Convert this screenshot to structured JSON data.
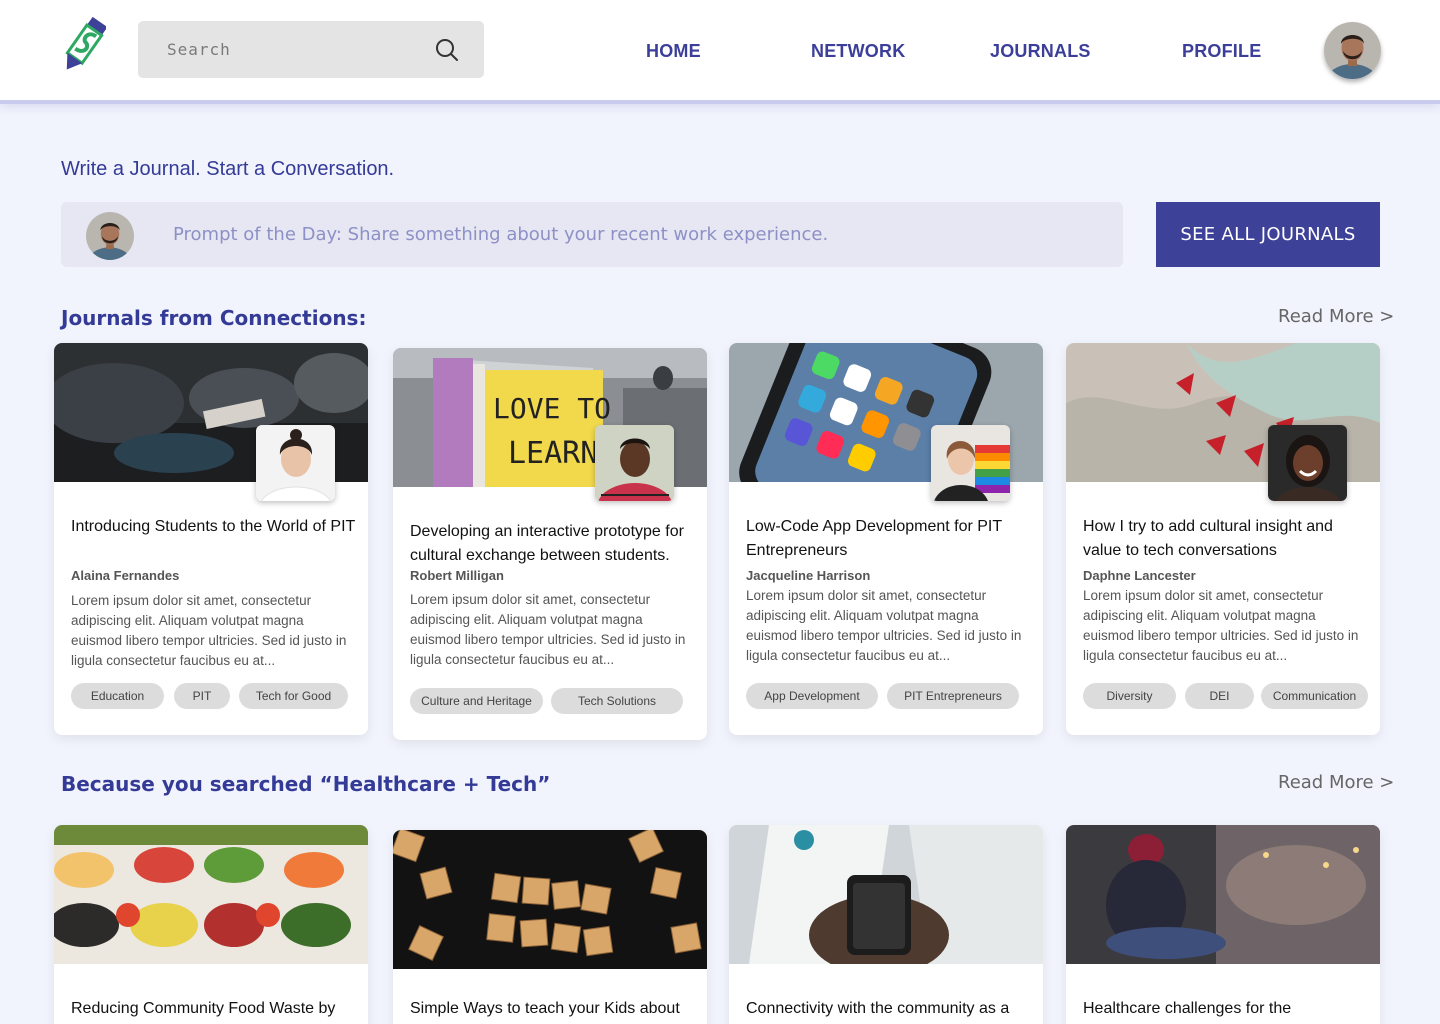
{
  "header": {
    "search_placeholder": "Search",
    "nav": [
      "HOME",
      "NETWORK",
      "JOURNALS",
      "PROFILE"
    ]
  },
  "intro": {
    "title": "Write a Journal. Start a Conversation.",
    "prompt": "Prompt of the Day: Share something about your recent work experience.",
    "see_all": "SEE ALL JOURNALS"
  },
  "connections": {
    "title": "Journals from Connections:",
    "read_more": "Read More >",
    "cards": [
      {
        "title": "Introducing Students to the World of PIT",
        "author": "Alaina Fernandes",
        "body": "Lorem ipsum dolor sit amet, consectetur adipiscing elit. Aliquam volutpat magna euismod libero tempor ultricies. Sed id justo in ligula consectetur faucibus eu at...",
        "tags": [
          "Education",
          "PIT",
          "Tech for Good"
        ]
      },
      {
        "title": "Developing an interactive prototype for cultural exchange between students.",
        "author": "Robert Milligan",
        "body": "Lorem ipsum dolor sit amet, consectetur adipiscing elit. Aliquam volutpat magna euismod libero tempor ultricies. Sed id justo in ligula consectetur faucibus eu at...",
        "tags": [
          "Culture and Heritage",
          "Tech Solutions"
        ]
      },
      {
        "title": "Low-Code App Development for PIT Entrepreneurs",
        "author": "Jacqueline Harrison",
        "body": "Lorem ipsum dolor sit amet, consectetur adipiscing elit. Aliquam volutpat magna euismod libero tempor ultricies. Sed id justo in ligula consectetur faucibus eu at...",
        "tags": [
          "App Development",
          "PIT Entrepreneurs"
        ]
      },
      {
        "title": "How I try to add cultural insight and value to tech conversations",
        "author": "Daphne Lancester",
        "body": "Lorem ipsum dolor sit amet, consectetur adipiscing elit. Aliquam volutpat magna euismod libero tempor ultricies. Sed id justo in ligula consectetur faucibus eu at...",
        "tags": [
          "Diversity",
          "DEI",
          "Communication"
        ]
      }
    ]
  },
  "searched": {
    "title": "Because you searched “Healthcare + Tech”",
    "read_more": "Read More >",
    "cards": [
      {
        "title": "Reducing Community Food Waste by"
      },
      {
        "title": "Simple Ways to teach your Kids about"
      },
      {
        "title": "Connectivity with the community as a"
      },
      {
        "title": "Healthcare challenges for the"
      }
    ]
  },
  "colors": {
    "brand": "#3e4198",
    "accent_text": "#343b96",
    "background": "#f1f3fd"
  },
  "icons": [
    "logo-pencil-icon",
    "search-icon",
    "user-avatar"
  ]
}
